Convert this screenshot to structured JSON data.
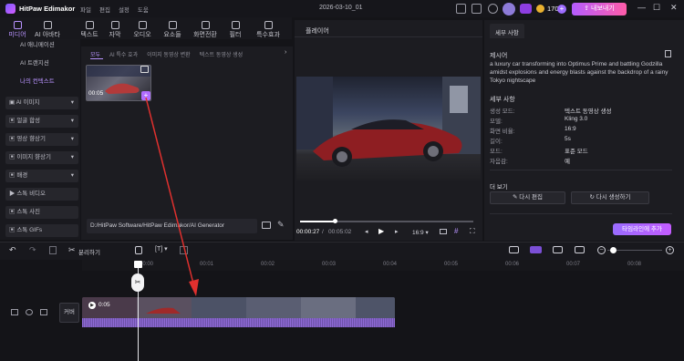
{
  "app": {
    "name": "HitPaw Edimakor",
    "menus": [
      "파일",
      "편집",
      "설정",
      "도움"
    ],
    "project_title": "2026-03-10_01",
    "credits": "17053",
    "export_label": "내보내기"
  },
  "toolbar": [
    {
      "label": "미디어",
      "active": true
    },
    {
      "label": "AI 아바타"
    },
    {
      "label": "텍스트"
    },
    {
      "label": "자막"
    },
    {
      "label": "오디오"
    },
    {
      "label": "요소들"
    },
    {
      "label": "화면전환"
    },
    {
      "label": "필터"
    },
    {
      "label": "특수효과"
    }
  ],
  "leftnav": {
    "plain": [
      "AI 애니메이션",
      "AI 트랜지션",
      "나의 컨텍스트"
    ],
    "boxed": [
      "AI 이미지",
      "얼굴 합성",
      "영상 향상기",
      "이미지 향상기",
      "배경",
      "스톡 비디오",
      "스톡 사진",
      "스톡 GIFs"
    ]
  },
  "media": {
    "tabs": [
      "모두",
      "AI 특수 효과",
      "이미지 동영상 변환",
      "텍스트 동영상 생성"
    ],
    "thumb_duration": "00:05",
    "path": "D:/HitPaw Software/HitPaw Edimakor/AI Generator"
  },
  "player": {
    "title": "플레이어",
    "time_current": "00:00:27",
    "time_total": "00:05:02",
    "ratio": "16:9",
    "progress": 0.2
  },
  "details": {
    "tab": "세부 사항",
    "prompt_label": "제시어",
    "prompt": "a luxury car transforming into Optimus Prime and battling Godzilla amidst explosions and energy blasts against the backdrop of a rainy Tokyo nightscape",
    "section": "세부 사항",
    "rows": [
      {
        "k": "생성 모드:",
        "v": "텍스트 동영상 생성"
      },
      {
        "k": "모델:",
        "v": "Kling 3.0"
      },
      {
        "k": "화면 비율:",
        "v": "16:9"
      },
      {
        "k": "길이:",
        "v": "5s"
      },
      {
        "k": "모드:",
        "v": "표준 모드"
      },
      {
        "k": "자음감:",
        "v": "예"
      }
    ],
    "more_label": "더 보기",
    "reedit": "다시 편집",
    "regen": "다시 생성하기",
    "add_timeline": "타임라인에 추가"
  },
  "timeline": {
    "split_label": "분리하기",
    "ruler": [
      "00:00",
      "00:01",
      "00:02",
      "00:03",
      "00:04",
      "00:05",
      "00:06",
      "00:07",
      "00:08",
      "00:09"
    ],
    "cover_label": "커버",
    "clip_duration": "0:05"
  }
}
